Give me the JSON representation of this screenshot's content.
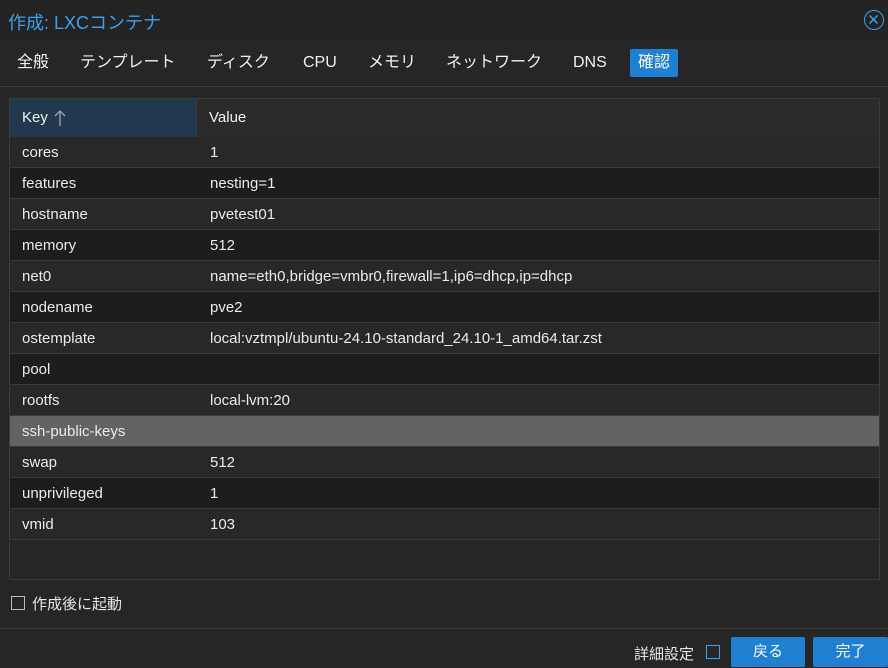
{
  "window": {
    "title": "作成: LXCコンテナ"
  },
  "tabs": [
    {
      "label": "全般"
    },
    {
      "label": "テンプレート"
    },
    {
      "label": "ディスク"
    },
    {
      "label": "CPU"
    },
    {
      "label": "メモリ"
    },
    {
      "label": "ネットワーク"
    },
    {
      "label": "DNS"
    },
    {
      "label": "確認",
      "active": true
    }
  ],
  "grid": {
    "headers": {
      "key": "Key",
      "value": "Value"
    },
    "sort": {
      "column": "Key",
      "direction": "ascending",
      "icon": "arrow-up-icon"
    },
    "rows": [
      {
        "key": "cores",
        "value": "1"
      },
      {
        "key": "features",
        "value": "nesting=1"
      },
      {
        "key": "hostname",
        "value": "pvetest01"
      },
      {
        "key": "memory",
        "value": "512"
      },
      {
        "key": "net0",
        "value": "name=eth0,bridge=vmbr0,firewall=1,ip6=dhcp,ip=dhcp"
      },
      {
        "key": "nodename",
        "value": "pve2"
      },
      {
        "key": "ostemplate",
        "value": "local:vztmpl/ubuntu-24.10-standard_24.10-1_amd64.tar.zst"
      },
      {
        "key": "pool",
        "value": ""
      },
      {
        "key": "rootfs",
        "value": "local-lvm:20"
      },
      {
        "key": "ssh-public-keys",
        "value": "",
        "selected": true
      },
      {
        "key": "swap",
        "value": "512"
      },
      {
        "key": "unprivileged",
        "value": "1"
      },
      {
        "key": "vmid",
        "value": "103"
      }
    ]
  },
  "start_after_create": {
    "label": "作成後に起動",
    "checked": false
  },
  "footer": {
    "advanced_label": "詳細設定",
    "advanced_checked": false,
    "back_label": "戻る",
    "finish_label": "完了"
  },
  "colors": {
    "accent": "#1f7fd1",
    "title": "#3fa0e8",
    "background": "#262626"
  }
}
